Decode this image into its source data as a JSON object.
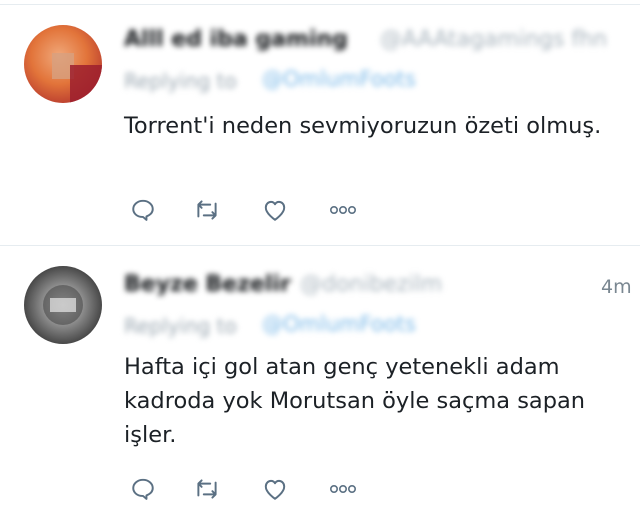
{
  "tweets": [
    {
      "display_name": "Alll ed iba gaming",
      "handle": "@AAAtagamings fhn",
      "reply_prefix": "Replying to",
      "reply_to": "@OmlumFoots",
      "text": "Torrent'i neden sevmiyoruzun özeti olmuş.",
      "timestamp": ""
    },
    {
      "display_name": "Beyze Bezelir",
      "handle": "@donibezilm",
      "reply_prefix": "Replying to",
      "reply_to": "@OmlumFoots",
      "text": "Hafta içi gol atan genç yetenekli adam kadroda yok Morutsan öyle saçma sapan işler.",
      "timestamp": "4m"
    }
  ],
  "icons": [
    "reply-icon",
    "retweet-icon",
    "like-icon",
    "more-icon"
  ],
  "colors": {
    "icon": "#5b7083",
    "link": "#1da1f2",
    "divider": "#e6ecf0"
  }
}
